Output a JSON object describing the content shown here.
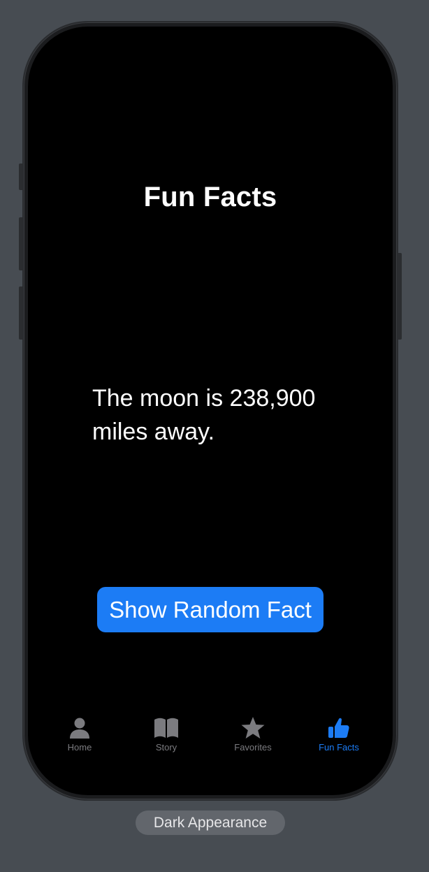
{
  "screen": {
    "title": "Fun Facts",
    "fact_text": "The moon is 238,900 miles away.",
    "button_label": "Show Random Fact"
  },
  "tabbar": {
    "items": [
      {
        "label": "Home",
        "icon": "person-icon",
        "active": false
      },
      {
        "label": "Story",
        "icon": "book-icon",
        "active": false
      },
      {
        "label": "Favorites",
        "icon": "star-icon",
        "active": false
      },
      {
        "label": "Fun Facts",
        "icon": "thumbs-up-icon",
        "active": true
      }
    ]
  },
  "preview": {
    "appearance_label": "Dark Appearance"
  },
  "colors": {
    "accent": "#1c7cf5",
    "background": "#000000",
    "inactive_tab": "#7b7b7f",
    "canvas": "#474c52"
  }
}
